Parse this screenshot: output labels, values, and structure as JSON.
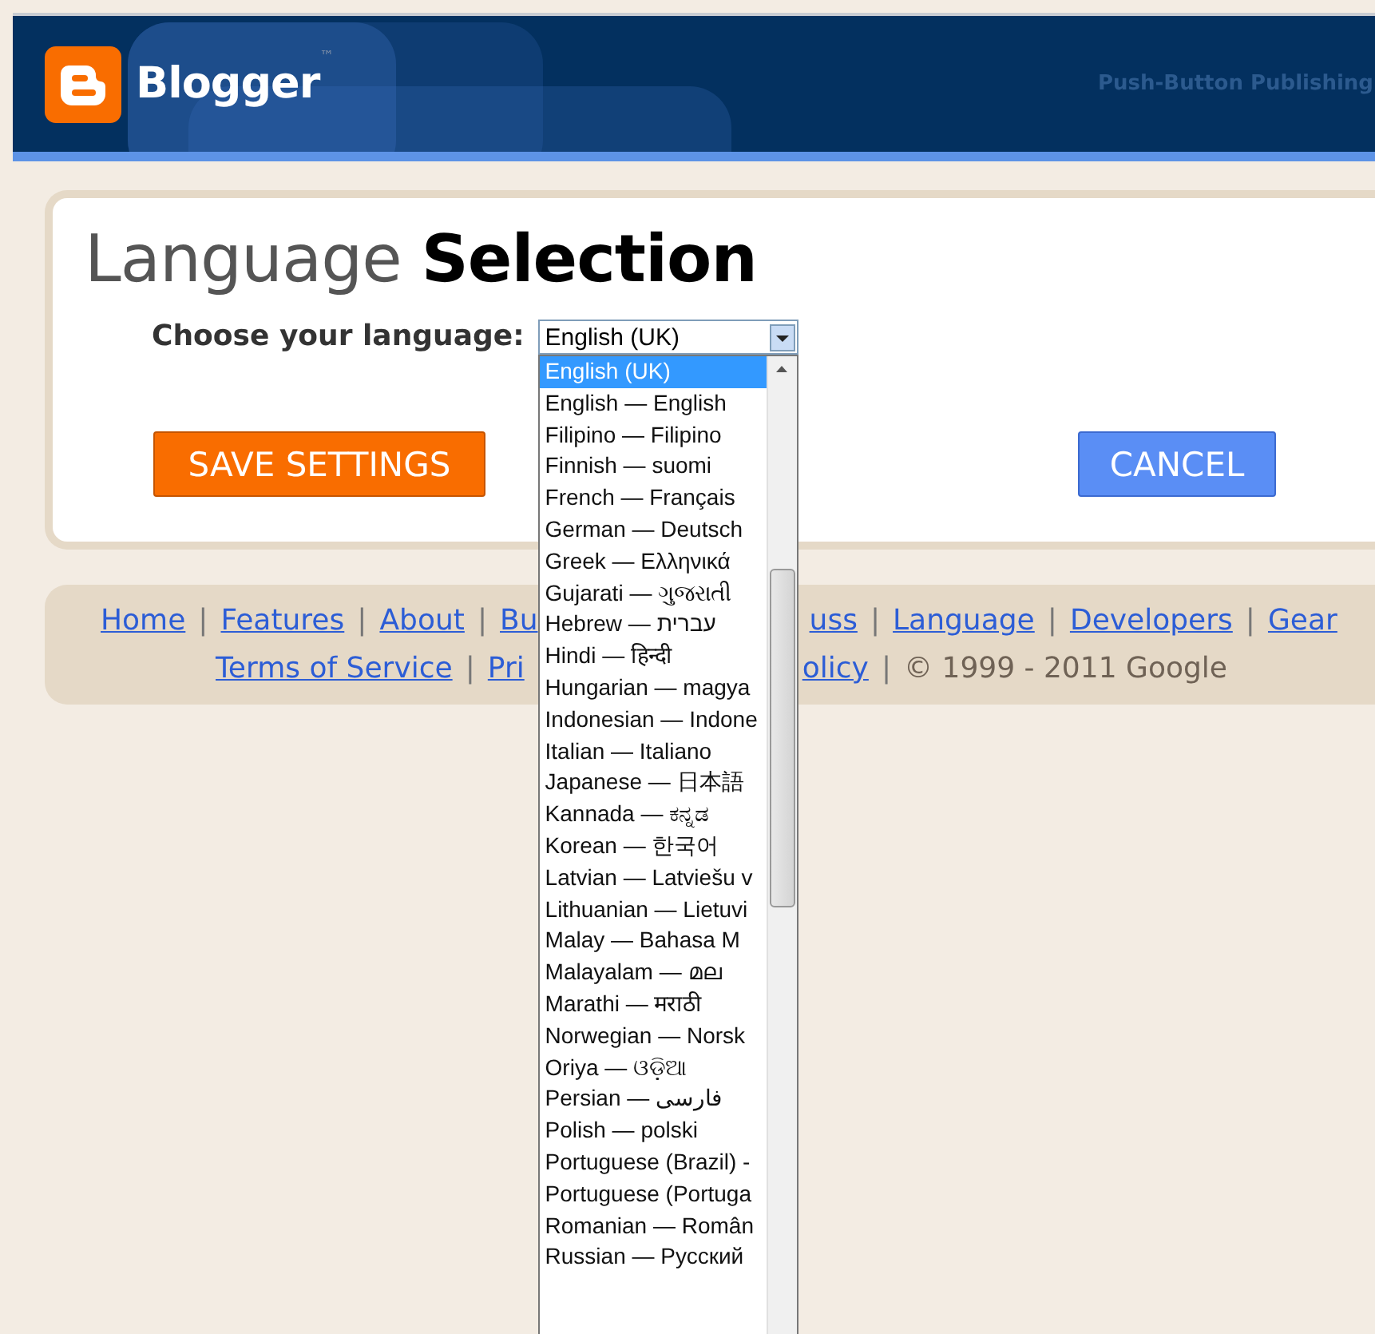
{
  "header": {
    "logo_text": "Blogger",
    "trademark": "™",
    "tagline": "Push-Button Publishing"
  },
  "page": {
    "title_light": "Language",
    "title_bold": "Selection",
    "label": "Choose your language:",
    "select": {
      "value": "English (UK)",
      "open": true,
      "options": [
        {
          "label": "English (UK)",
          "selected": true
        },
        {
          "label": "English — English",
          "selected": false
        },
        {
          "label": "Filipino — Filipino",
          "selected": false
        },
        {
          "label": "Finnish — suomi",
          "selected": false
        },
        {
          "label": "French — Français",
          "selected": false
        },
        {
          "label": "German — Deutsch",
          "selected": false
        },
        {
          "label": "Greek — Ελληνικά",
          "selected": false
        },
        {
          "label": "Gujarati — ગુજરાતી",
          "selected": false
        },
        {
          "label": "Hebrew — עברית",
          "selected": false
        },
        {
          "label": "Hindi — हिन्दी",
          "selected": false
        },
        {
          "label": "Hungarian — magya",
          "selected": false
        },
        {
          "label": "Indonesian — Indone",
          "selected": false
        },
        {
          "label": "Italian — Italiano",
          "selected": false
        },
        {
          "label": "Japanese — 日本語",
          "selected": false
        },
        {
          "label": "Kannada — ಕನ್ನಡ",
          "selected": false
        },
        {
          "label": "Korean — 한국어",
          "selected": false
        },
        {
          "label": "Latvian — Latviešu v",
          "selected": false
        },
        {
          "label": "Lithuanian — Lietuvi",
          "selected": false
        },
        {
          "label": "Malay — Bahasa M",
          "selected": false
        },
        {
          "label": "Malayalam — മല",
          "selected": false
        },
        {
          "label": "Marathi — मराठी",
          "selected": false
        },
        {
          "label": "Norwegian — Norsk",
          "selected": false
        },
        {
          "label": "Oriya — ଓଡ଼ିଆ",
          "selected": false
        },
        {
          "label": "Persian — فارسی",
          "selected": false
        },
        {
          "label": "Polish — polski",
          "selected": false
        },
        {
          "label": "Portuguese (Brazil) -",
          "selected": false
        },
        {
          "label": "Portuguese (Portuga",
          "selected": false
        },
        {
          "label": "Romanian — Român",
          "selected": false
        },
        {
          "label": "Russian — Русский",
          "selected": false
        }
      ]
    },
    "buttons": [
      {
        "label": "SAVE SETTINGS",
        "kind": "primary"
      },
      {
        "label": "CANCEL",
        "kind": "secondary"
      }
    ]
  },
  "footer": {
    "lines": [
      {
        "items": [
          {
            "text": "Home",
            "kind": "link"
          },
          {
            "text": "|",
            "kind": "separator"
          },
          {
            "text": "Features",
            "kind": "link"
          },
          {
            "text": "|",
            "kind": "separator"
          },
          {
            "text": "About",
            "kind": "link"
          },
          {
            "text": "|",
            "kind": "separator"
          },
          {
            "text": "Bu",
            "kind": "link"
          },
          {
            "text": "uss",
            "kind": "link"
          },
          {
            "text": "|",
            "kind": "separator"
          },
          {
            "text": "Language",
            "kind": "link"
          },
          {
            "text": "|",
            "kind": "separator"
          },
          {
            "text": "Developers",
            "kind": "link"
          },
          {
            "text": "|",
            "kind": "separator"
          },
          {
            "text": "Gear",
            "kind": "link"
          }
        ]
      },
      {
        "items": [
          {
            "text": "Terms of Service",
            "kind": "link"
          },
          {
            "text": "|",
            "kind": "separator"
          },
          {
            "text": "Pri",
            "kind": "link"
          },
          {
            "text": "olicy",
            "kind": "link"
          },
          {
            "text": "|",
            "kind": "separator"
          },
          {
            "text": "© 1999 - 2011 Google",
            "kind": "text"
          }
        ]
      }
    ]
  }
}
